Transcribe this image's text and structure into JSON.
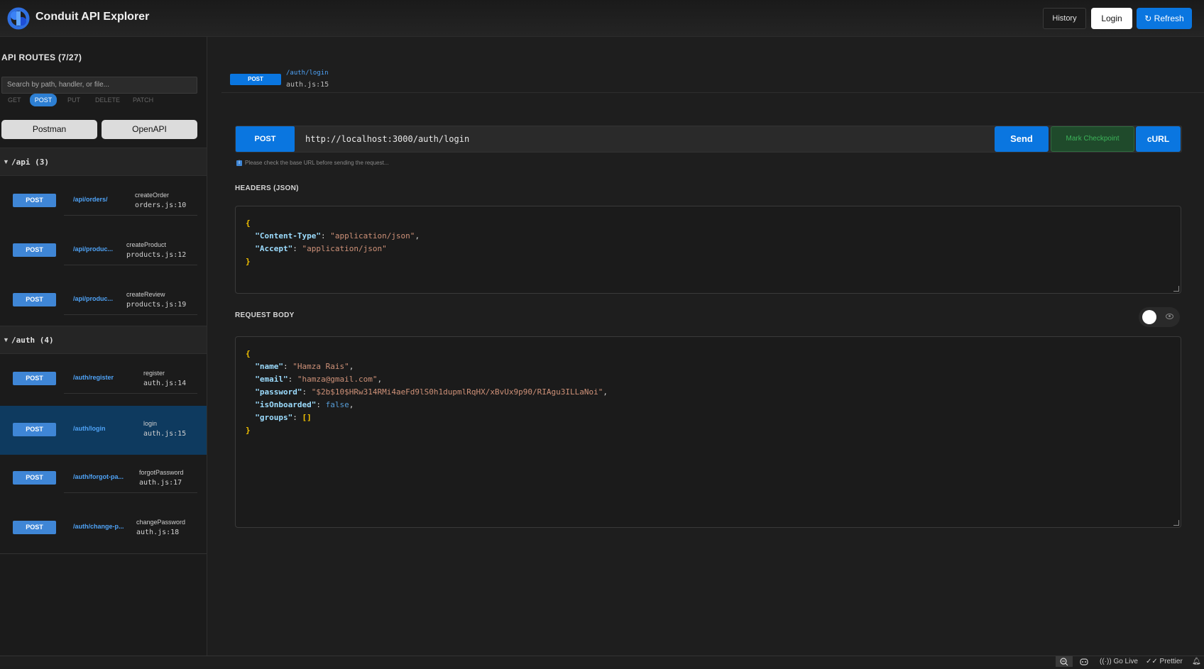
{
  "app": {
    "title": "Conduit API Explorer"
  },
  "header": {
    "history_label": "History",
    "login_label": "Login",
    "refresh_label": "↻ Refresh"
  },
  "sidebar": {
    "title": "API ROUTES (7/27)",
    "search_placeholder": "Search by path, handler, or file...",
    "method_filters": [
      "GET",
      "POST",
      "PUT",
      "DELETE",
      "PATCH"
    ],
    "active_filter": "POST",
    "postman_label": "Postman",
    "openapi_label": "OpenAPI",
    "groups": [
      {
        "name": "/api (3)",
        "routes": [
          {
            "method": "POST",
            "path": "/api/orders/",
            "handler": "createOrder",
            "file": "orders.js:10"
          },
          {
            "method": "POST",
            "path": "/api/produc...",
            "handler": "createProduct",
            "file": "products.js:12"
          },
          {
            "method": "POST",
            "path": "/api/produc...",
            "handler": "createReview",
            "file": "products.js:19"
          }
        ]
      },
      {
        "name": "/auth (4)",
        "routes": [
          {
            "method": "POST",
            "path": "/auth/register",
            "handler": "register",
            "file": "auth.js:14"
          },
          {
            "method": "POST",
            "path": "/auth/login",
            "handler": "login",
            "file": "auth.js:15"
          },
          {
            "method": "POST",
            "path": "/auth/forgot-pa...",
            "handler": "forgotPassword",
            "file": "auth.js:17"
          },
          {
            "method": "POST",
            "path": "/auth/change-p...",
            "handler": "changePassword",
            "file": "auth.js:18"
          }
        ]
      }
    ]
  },
  "current": {
    "method": "POST",
    "path": "/auth/login",
    "file": "auth.js:15"
  },
  "request": {
    "method": "POST",
    "url": "http://localhost:3000/auth/login",
    "send_label": "Send",
    "checkpoint_label": "Mark Checkpoint",
    "curl_label": "cURL",
    "note": "Please check the base URL before sending the request...",
    "headers_label": "HEADERS (JSON)",
    "headers": {
      "open": "{",
      "close": "}",
      "k1": "\"Content-Type\"",
      "v1": "\"application/json\"",
      "k2": "\"Accept\"",
      "v2": "\"application/json\""
    },
    "body_label": "REQUEST BODY",
    "body": {
      "open": "{",
      "close": "}",
      "k_name": "\"name\"",
      "v_name": "\"Hamza Rais\"",
      "k_email": "\"email\"",
      "v_email": "\"hamza@gmail.com\"",
      "k_password": "\"password\"",
      "v_password": "\"$2b$10$HRw314RMi4aeFd9lS0h1dupmlRqHX/xBvUx9p90/RIAgu3ILLaNoi\"",
      "k_onboarded": "\"isOnboarded\"",
      "v_onboarded": "false",
      "k_groups": "\"groups\"",
      "v_groups": "[]"
    }
  },
  "statusbar": {
    "golive_label": "Go Live",
    "prettier_label": "Prettier"
  }
}
